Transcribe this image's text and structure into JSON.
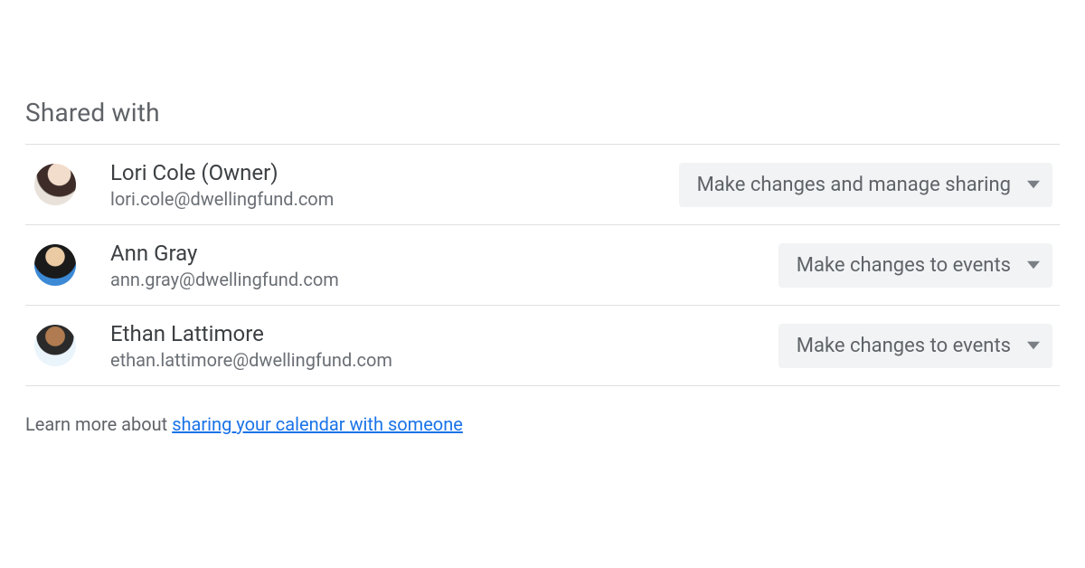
{
  "section": {
    "title": "Shared with"
  },
  "people": [
    {
      "name": "Lori Cole (Owner)",
      "email": "lori.cole@dwellingfund.com",
      "permission": "Make changes and manage sharing"
    },
    {
      "name": "Ann Gray",
      "email": "ann.gray@dwellingfund.com",
      "permission": "Make changes to events"
    },
    {
      "name": "Ethan Lattimore",
      "email": "ethan.lattimore@dwellingfund.com",
      "permission": "Make changes to events"
    }
  ],
  "learn_more": {
    "prefix": "Learn more about ",
    "link_text": "sharing your calendar with someone"
  }
}
